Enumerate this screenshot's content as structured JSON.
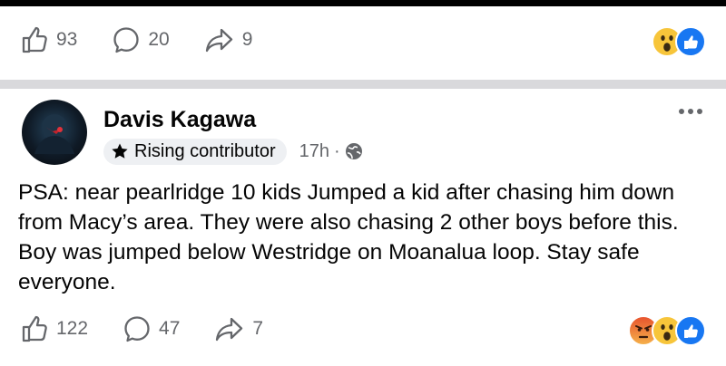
{
  "prev_post": {
    "likes": "93",
    "comments": "20",
    "shares": "9",
    "reactions": [
      "wow-icon",
      "like-icon"
    ]
  },
  "post": {
    "author": "Davis Kagawa",
    "badge": "Rising contributor",
    "time": "17h",
    "separator": "·",
    "audience_icon": "globe-icon",
    "text": "PSA: near pearlridge 10 kids Jumped a kid after chasing him down from Macy’s area. They were also chasing 2 other boys before this. Boy was jumped below Westridge on Moanalua loop. Stay safe everyone.",
    "likes": "122",
    "comments": "47",
    "shares": "7",
    "reactions": [
      "angry-icon",
      "wow-icon",
      "like-icon"
    ]
  },
  "colors": {
    "like_blue": "#1877f2",
    "muted": "#65676b",
    "wow_yellow": "#f7c53a",
    "angry_orange": "#e8542e"
  }
}
